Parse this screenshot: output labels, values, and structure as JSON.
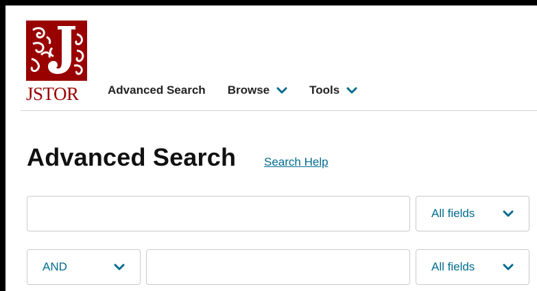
{
  "brand": {
    "name": "JSTOR",
    "color": "#990000"
  },
  "nav": {
    "items": [
      {
        "label": "Advanced Search",
        "has_dropdown": false
      },
      {
        "label": "Browse",
        "has_dropdown": true,
        "icon": "chevron-down-icon"
      },
      {
        "label": "Tools",
        "has_dropdown": true,
        "icon": "chevron-down-icon"
      }
    ]
  },
  "page": {
    "title": "Advanced Search",
    "help_link": "Search Help"
  },
  "search_rows": [
    {
      "operator": null,
      "query": "",
      "field": "All fields"
    },
    {
      "operator": "AND",
      "query": "",
      "field": "All fields"
    }
  ],
  "colors": {
    "accent": "#006b8f",
    "brand": "#990000"
  }
}
